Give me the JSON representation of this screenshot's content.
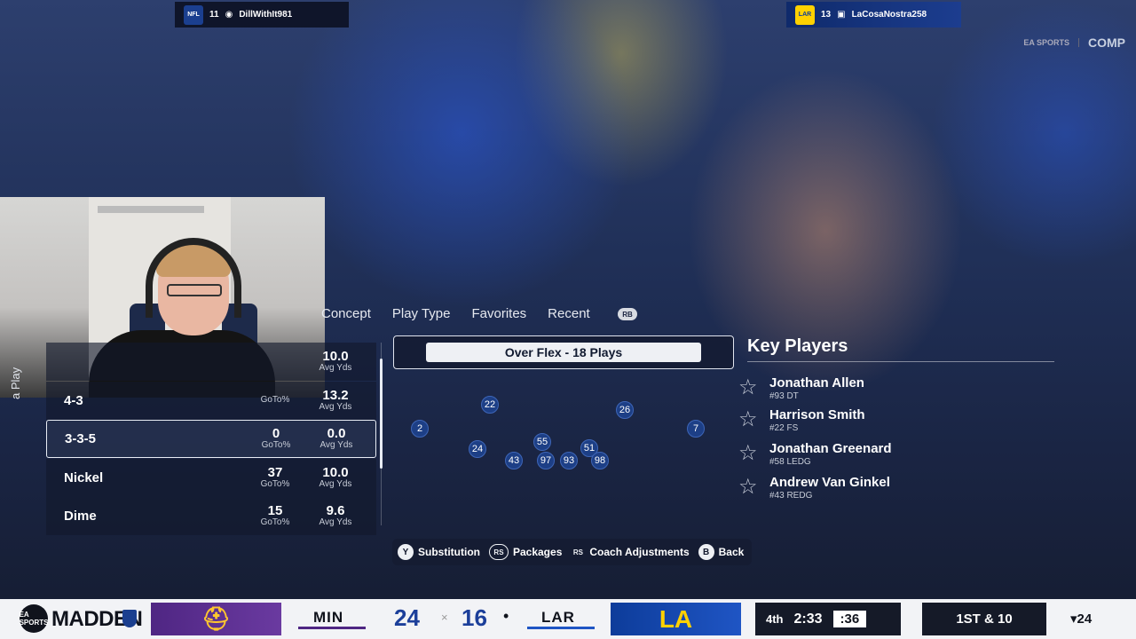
{
  "top_bar": {
    "away": {
      "logo_text": "NFL",
      "rank": "11",
      "gamertag": "DillWithIt981"
    },
    "home": {
      "logo_text": "LAR",
      "rank": "13",
      "gamertag": "LaCosaNostra258"
    },
    "ea_small": "EA SPORTS",
    "mode": "COMP"
  },
  "tabs": [
    "Concept",
    "Play Type",
    "Favorites",
    "Recent"
  ],
  "rb_button": "RB",
  "side_label": "a Play",
  "formations": [
    {
      "name": "",
      "goto": "",
      "goto_label": "",
      "avg": "10.0",
      "avg_label": "Avg Yds"
    },
    {
      "name": "4-3",
      "goto": "",
      "goto_label": "GoTo%",
      "avg": "13.2",
      "avg_label": "Avg Yds"
    },
    {
      "name": "3-3-5",
      "goto": "0",
      "goto_label": "GoTo%",
      "avg": "0.0",
      "avg_label": "Avg Yds"
    },
    {
      "name": "Nickel",
      "goto": "37",
      "goto_label": "GoTo%",
      "avg": "10.0",
      "avg_label": "Avg Yds"
    },
    {
      "name": "Dime",
      "goto": "15",
      "goto_label": "GoTo%",
      "avg": "9.6",
      "avg_label": "Avg Yds"
    }
  ],
  "playset": "Over Flex - 18 Plays",
  "players_on_field": [
    "22",
    "26",
    "2",
    "7",
    "55",
    "51",
    "24",
    "43",
    "97",
    "93",
    "98"
  ],
  "key_players": {
    "title": "Key Players",
    "list": [
      {
        "name": "Jonathan Allen",
        "pos": "#93 DT"
      },
      {
        "name": "Harrison Smith",
        "pos": "#22 FS"
      },
      {
        "name": "Jonathan Greenard",
        "pos": "#58 LEDG"
      },
      {
        "name": "Andrew Van Ginkel",
        "pos": "#43 REDG"
      }
    ]
  },
  "controls": [
    {
      "button": "Y",
      "label": "Substitution"
    },
    {
      "button": "RS",
      "label": "Packages"
    },
    {
      "button": "RS",
      "label": "Coach Adjustments"
    },
    {
      "button": "B",
      "label": "Back"
    }
  ],
  "scorebug": {
    "brand_small": "EA SPORTS",
    "brand": "MADDEN",
    "away_abbr": "MIN",
    "away_score": "24",
    "separator": "×",
    "home_score": "16",
    "possession": "•",
    "home_abbr": "LAR",
    "home_logo": "LA",
    "quarter": "4th",
    "clock": "2:33",
    "play_clock": ":36",
    "down_distance": "1ST & 10",
    "ball_on": "▾24"
  },
  "colors": {
    "vikings_purple": "#4f2683",
    "rams_blue": "#1f55c4",
    "rams_gold": "#ffd100",
    "player_dot": "#1d3f86"
  }
}
